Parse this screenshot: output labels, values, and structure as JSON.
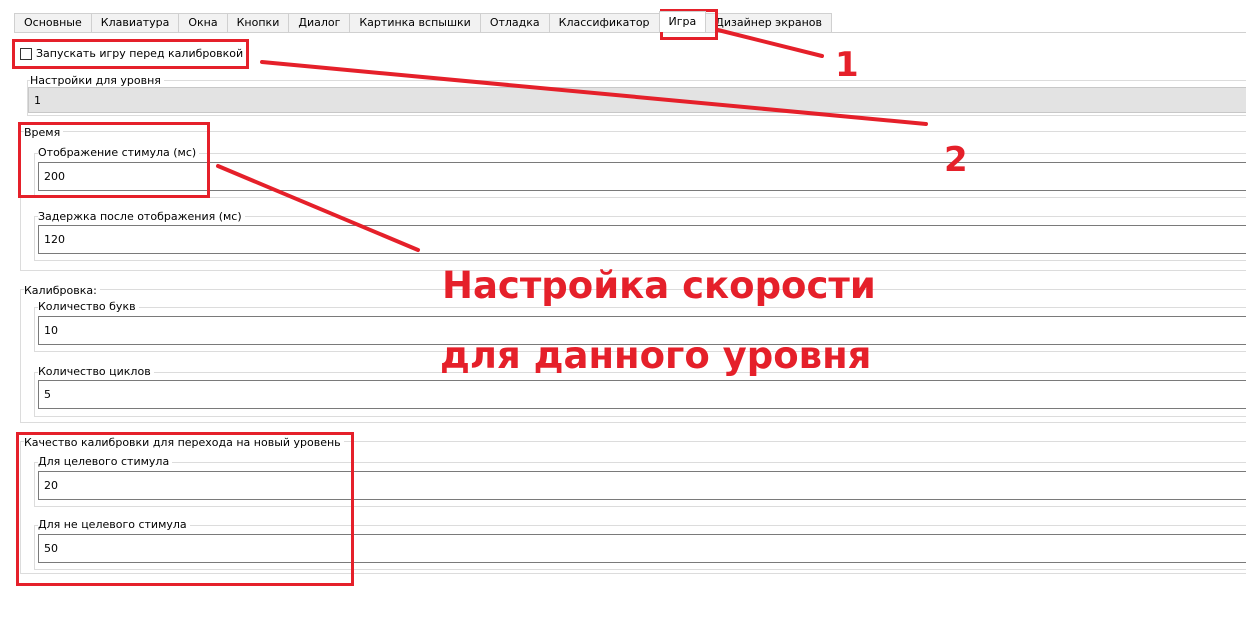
{
  "tabs": [
    {
      "label": "Основные",
      "active": false
    },
    {
      "label": "Клавиатура",
      "active": false
    },
    {
      "label": "Окна",
      "active": false
    },
    {
      "label": "Кнопки",
      "active": false
    },
    {
      "label": "Диалог",
      "active": false
    },
    {
      "label": "Картинка вспышки",
      "active": false
    },
    {
      "label": "Отладка",
      "active": false
    },
    {
      "label": "Классификатор",
      "active": false
    },
    {
      "label": "Игра",
      "active": true
    },
    {
      "label": "Дизайнер экранов",
      "active": false
    }
  ],
  "checkbox": {
    "label": "Запускать игру перед калибровкой",
    "checked": false
  },
  "level_settings": {
    "label": "Настройки для уровня",
    "value": "1"
  },
  "time": {
    "label": "Время",
    "stimulus_display": {
      "label": "Отображение стимула (мс)",
      "value": "200"
    },
    "delay_after": {
      "label": "Задержка после отображения (мс)",
      "value": "120"
    }
  },
  "calibration": {
    "label": "Калибровка:",
    "letters": {
      "label": "Количество букв",
      "value": "10"
    },
    "cycles": {
      "label": "Количество циклов",
      "value": "5"
    }
  },
  "quality": {
    "label": "Качество калибровки для перехода на новый уровень",
    "target": {
      "label": "Для целевого стимула",
      "value": "20"
    },
    "nontarget": {
      "label": "Для не целевого стимула",
      "value": "50"
    }
  },
  "annotations": {
    "num1": "1",
    "num2": "2",
    "line1": "Настройка скорости",
    "line2": "для данного уровня",
    "color": "#e5202a"
  }
}
